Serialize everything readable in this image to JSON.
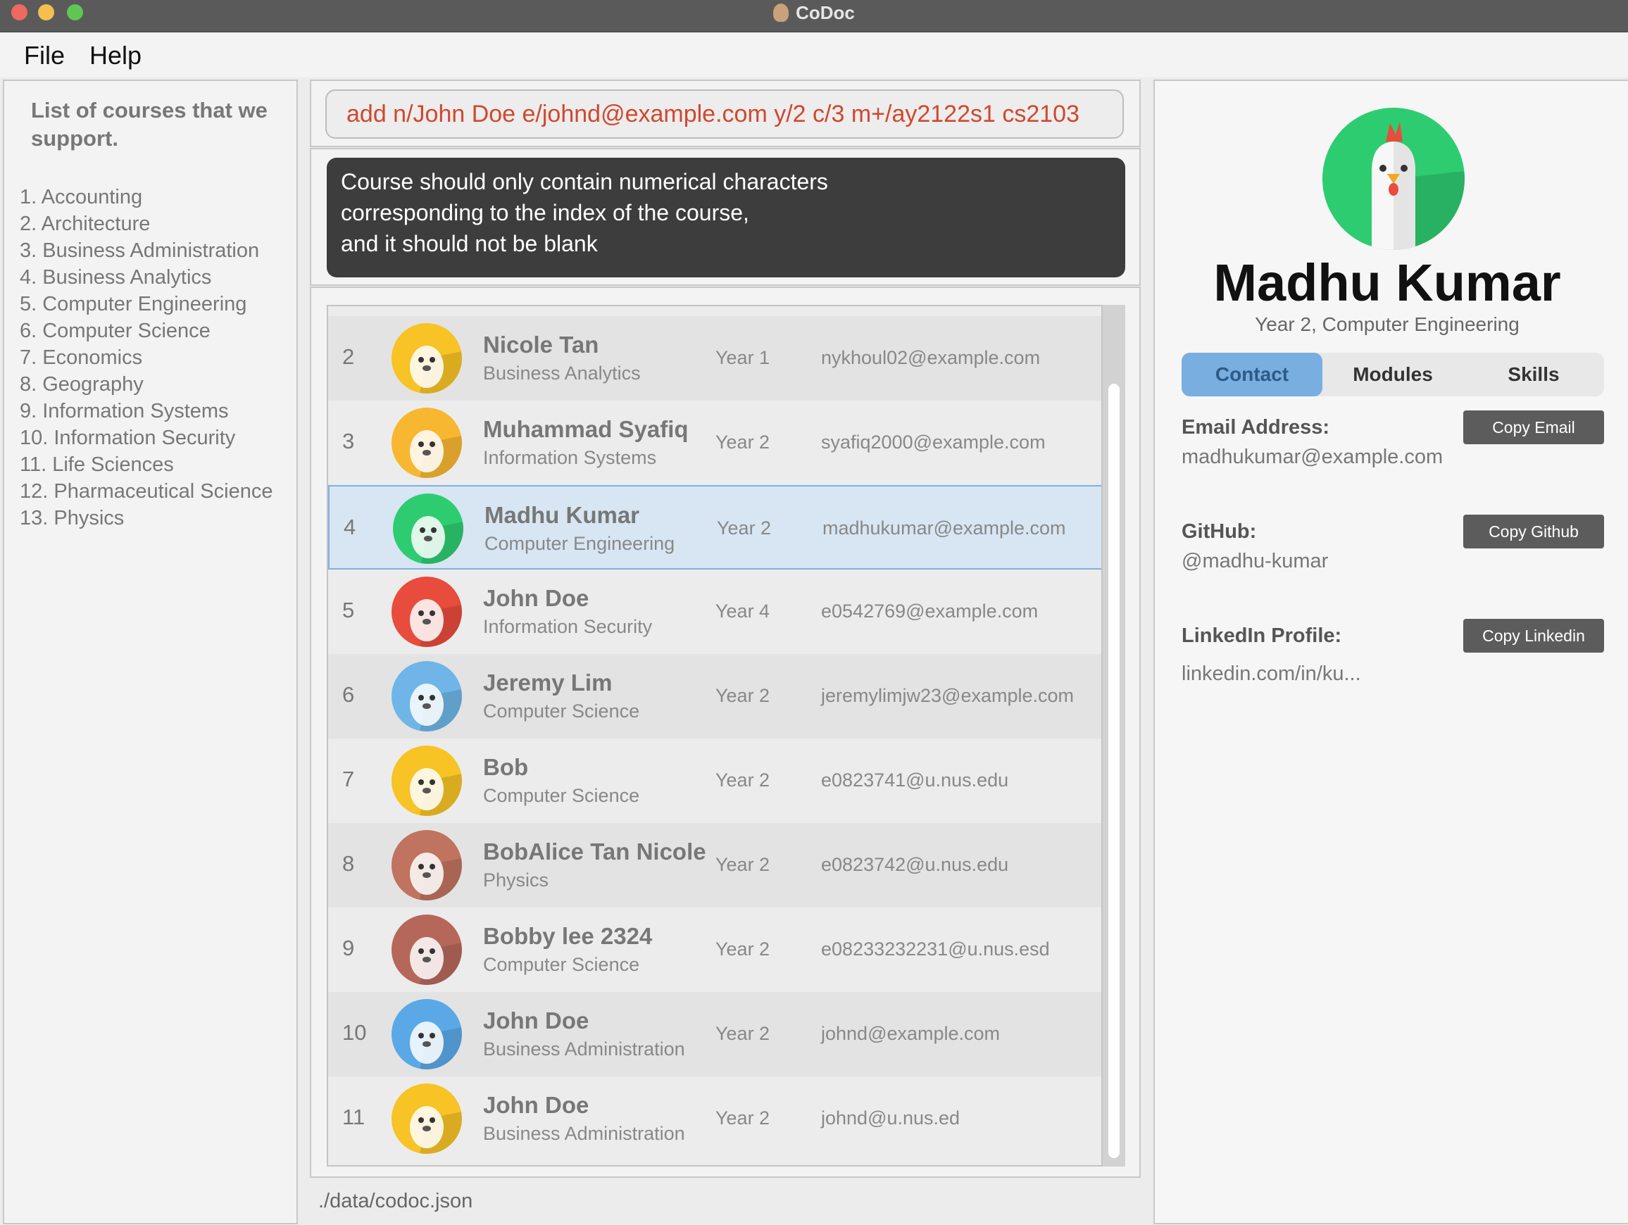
{
  "window": {
    "title": "CoDoc"
  },
  "menu": {
    "file": "File",
    "help": "Help"
  },
  "courses": {
    "title": "List of courses that we support.",
    "items": [
      "1. Accounting",
      "2. Architecture",
      "3. Business Administration",
      "4. Business Analytics",
      "5. Computer Engineering",
      "6. Computer Science",
      "7. Economics",
      "8. Geography",
      "9. Information Systems",
      "10. Information Security",
      "11. Life Sciences",
      "12. Pharmaceutical Science",
      "13. Physics"
    ]
  },
  "command": {
    "value": "add n/John Doe e/johnd@example.com y/2 c/3 m+/ay2122s1 cs2103"
  },
  "result": {
    "message": "Course should only contain numerical characters\ncorresponding to the index of the course,\nand it should not be blank"
  },
  "people": [
    {
      "index": "2",
      "name": "Nicole Tan",
      "course": "Business Analytics",
      "year": "Year 1",
      "email": "nykhoul02@example.com",
      "avatar": "panda-icon",
      "color": "#f7c325"
    },
    {
      "index": "3",
      "name": "Muhammad Syafiq",
      "course": "Information Systems",
      "year": "Year 2",
      "email": "syafiq2000@example.com",
      "avatar": "sloth-icon",
      "color": "#f7b731"
    },
    {
      "index": "4",
      "name": "Madhu Kumar",
      "course": "Computer Engineering",
      "year": "Year 2",
      "email": "madhukumar@example.com",
      "avatar": "chicken-icon",
      "color": "#2ecc71",
      "selected": true
    },
    {
      "index": "5",
      "name": "John Doe",
      "course": "Information Security",
      "year": "Year 4",
      "email": "e0542769@example.com",
      "avatar": "pufferfish-icon",
      "color": "#e74c3c"
    },
    {
      "index": "6",
      "name": "Jeremy Lim",
      "course": "Computer Science",
      "year": "Year 2",
      "email": "jeremylimjw23@example.com",
      "avatar": "beaver-icon",
      "color": "#6fb5e8"
    },
    {
      "index": "7",
      "name": "Bob",
      "course": "Computer Science",
      "year": "Year 2",
      "email": "e0823741@u.nus.edu",
      "avatar": "bear-icon",
      "color": "#f7c325"
    },
    {
      "index": "8",
      "name": "BobAlice Tan Nicole",
      "course": "Physics",
      "year": "Year 2",
      "email": "e0823742@u.nus.edu",
      "avatar": "koala-icon",
      "color": "#c0735f"
    },
    {
      "index": "9",
      "name": "Bobby lee 2324",
      "course": "Computer Science",
      "year": "Year 2",
      "email": "e08233232231@u.nus.esd",
      "avatar": "elephant-icon",
      "color": "#b5685a"
    },
    {
      "index": "10",
      "name": "John Doe",
      "course": "Business Administration",
      "year": "Year 2",
      "email": "johnd@example.com",
      "avatar": "penguin-icon",
      "color": "#5aa9e6"
    },
    {
      "index": "11",
      "name": "John Doe",
      "course": "Business Administration",
      "year": "Year 2",
      "email": "johnd@u.nus.ed",
      "avatar": "duck-icon",
      "color": "#f7c325"
    }
  ],
  "status": {
    "path": "./data/codoc.json"
  },
  "detail": {
    "name": "Madhu Kumar",
    "subtitle": "Year 2, Computer Engineering",
    "avatar": "chicken-icon",
    "tabs": [
      "Contact",
      "Modules",
      "Skills"
    ],
    "active_tab": "Contact",
    "email_label": "Email Address:",
    "email_value": "madhukumar@example.com",
    "copy_email": "Copy Email",
    "github_label": "GitHub:",
    "github_value": "@madhu-kumar",
    "copy_github": "Copy Github",
    "linkedin_label": "LinkedIn Profile:",
    "linkedin_value": "linkedin.com/in/ku...",
    "copy_linkedin": "Copy Linkedin"
  },
  "colors": {
    "accent": "#78aee0",
    "selected_row": "#d7e6f2",
    "command_text": "#d0482f",
    "result_bg": "#3d3d3d",
    "button_bg": "#5c5c5c"
  }
}
